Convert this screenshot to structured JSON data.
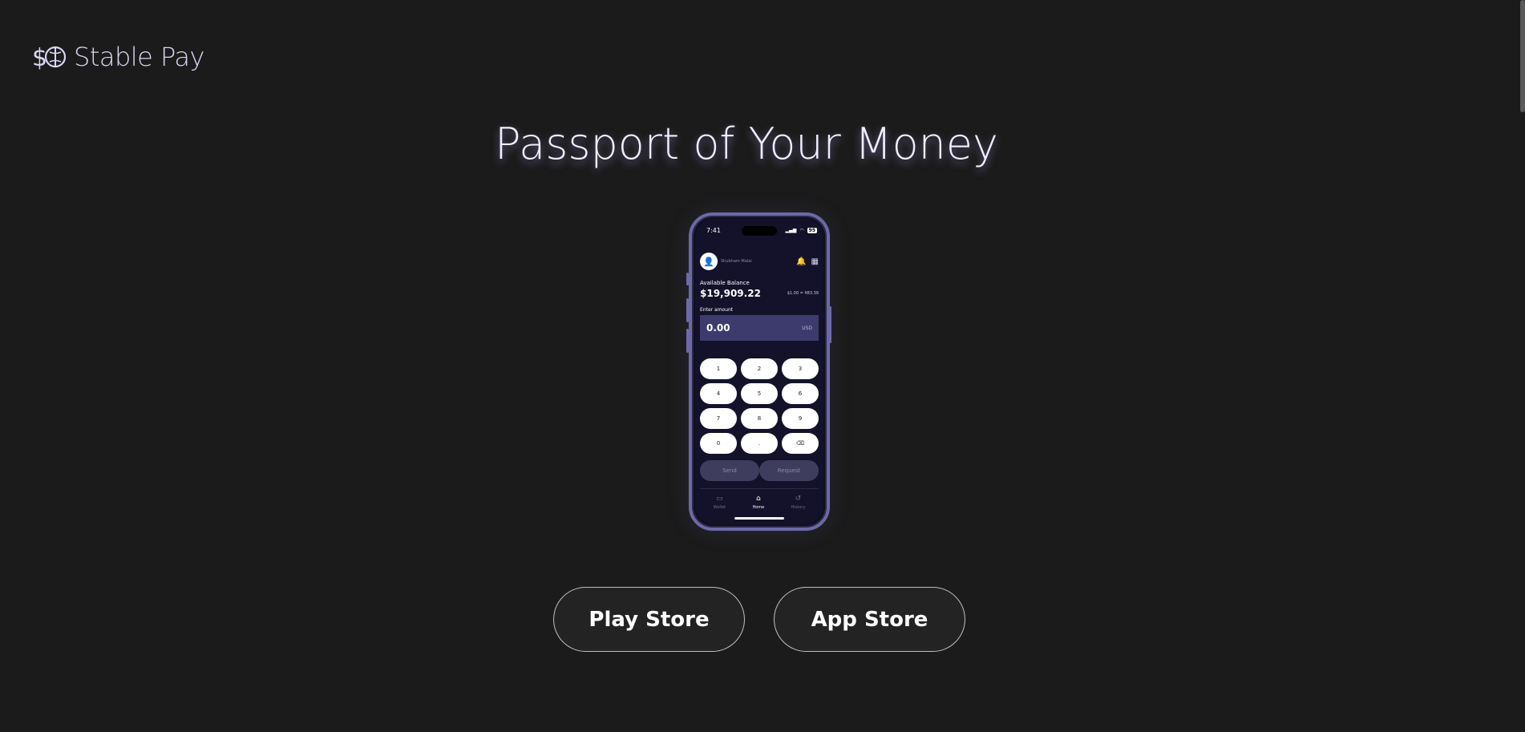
{
  "brand": {
    "name": "Stable Pay",
    "logo_icon": "dollar-globe-icon",
    "accent_color": "#d9d6f2"
  },
  "hero": {
    "title": "Passport of Your Money"
  },
  "phone": {
    "status_time": "7:41",
    "battery": "95",
    "user_name": "Shubham Malai",
    "balance_label": "Available Balance",
    "balance_value": "$19,909.22",
    "rate": "$1.00 = ₹83.39",
    "enter_label": "Enter amount",
    "amount_value": "0.00",
    "amount_currency": "USD",
    "keys": [
      "1",
      "2",
      "3",
      "4",
      "5",
      "6",
      "7",
      "8",
      "9",
      "0",
      "."
    ],
    "send_label": "Send",
    "request_label": "Request",
    "tabs": [
      {
        "label": "Wallet",
        "icon": "wallet-icon"
      },
      {
        "label": "Home",
        "icon": "home-icon"
      },
      {
        "label": "History",
        "icon": "history-icon"
      }
    ]
  },
  "stores": {
    "play_label": "Play Store",
    "app_label": "App Store"
  }
}
